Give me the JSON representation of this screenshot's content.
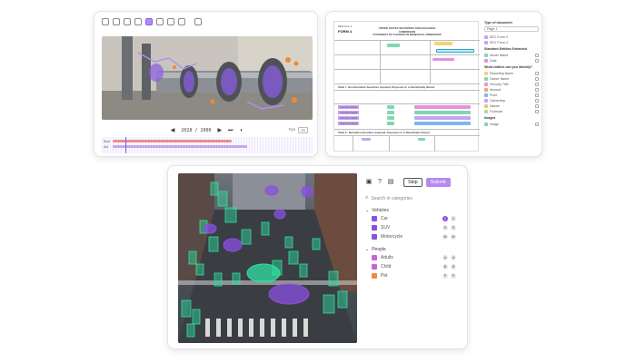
{
  "video_card": {
    "toolbar_icons": [
      "pointer-icon",
      "polyline-icon",
      "box-icon",
      "link-icon",
      "polygon-icon",
      "hand-icon",
      "undo-icon",
      "fit-icon",
      "trash-icon"
    ],
    "active_tool_index": 4,
    "frame_counter": "2028 / 2000",
    "speed_label": "2x",
    "speed_prefix": "Fps",
    "track_labels": [
      "Mod",
      "Act"
    ],
    "tracks": [
      {
        "color": "#e88f8f",
        "start": 0.0,
        "end": 0.6
      },
      {
        "color": "#c7a6f0",
        "start": 0.0,
        "end": 0.68
      }
    ],
    "playhead": 0.11,
    "colors": {
      "accent": "#8a5de0",
      "annotation": "#8c5ef0"
    }
  },
  "doc_card": {
    "form_header": "SEC Form 4",
    "form_name": "FORM 4",
    "commission": "UNITED STATES SECURITIES AND EXCHANGE COMMISSION",
    "statement": "STATEMENT OF CHANGES IN BENEFICIAL OWNERSHIP",
    "table1_title": "Table I - Non-Derivative Securities Acquired, Disposed of, or Beneficially Owned",
    "table2_title": "Table II - Derivative Securities Acquired, Disposed of, or Beneficially Owned",
    "row_label": "Common Stock",
    "sidebar": {
      "doc_type_label": "Type of document",
      "doc_type_value": "Page 1",
      "doc_items": [
        "SEC Form 4",
        "SEC Form 4"
      ],
      "section_label": "Standard Entities Extracted",
      "section2_label": "What entities can you identify?",
      "section3_label": "Images",
      "entities": [
        {
          "label": "Issuer Name",
          "color": "#7fd7b0"
        },
        {
          "label": "Date",
          "color": "#e98fe2"
        },
        {
          "label": "Reporting Name",
          "color": "#f5d27a"
        },
        {
          "label": "Owner Name",
          "color": "#7fd7b0"
        },
        {
          "label": "Security Title",
          "color": "#e98fe2"
        },
        {
          "label": "Amount",
          "color": "#f0a66e"
        },
        {
          "label": "Price",
          "color": "#7fb6f0"
        },
        {
          "label": "Ownership",
          "color": "#c6a3f2"
        },
        {
          "label": "Nature",
          "color": "#f0c36e"
        },
        {
          "label": "Footnote",
          "color": "#a5e08d"
        }
      ],
      "image_entity": {
        "label": "Image",
        "color": "#7fd7b0"
      }
    }
  },
  "street_card": {
    "skip_label": "Skip",
    "submit_label": "Submit",
    "search_placeholder": "Search in categories",
    "groups": [
      {
        "name": "Vehicles",
        "items": [
          {
            "label": "Car",
            "color": "#8a4fe0",
            "keys": [
              "C",
              "C"
            ]
          },
          {
            "label": "SUV",
            "color": "#8a4fe0",
            "keys": [
              "S",
              "S"
            ]
          },
          {
            "label": "Motorcycle",
            "color": "#8a4fe0",
            "keys": [
              "M",
              "M"
            ]
          }
        ]
      },
      {
        "name": "People",
        "items": [
          {
            "label": "Adults",
            "color": "#cf5fe0",
            "keys": [
              "A",
              "A"
            ]
          },
          {
            "label": "Child",
            "color": "#cf5fe0",
            "keys": [
              "B",
              "B"
            ]
          },
          {
            "label": "Pet",
            "color": "#f0883e",
            "keys": [
              "P",
              "P"
            ]
          }
        ]
      }
    ],
    "colors": {
      "vehicle_box": "#8a4fe0",
      "person_box": "#2fe0a0",
      "submit": "#b48af0"
    }
  }
}
